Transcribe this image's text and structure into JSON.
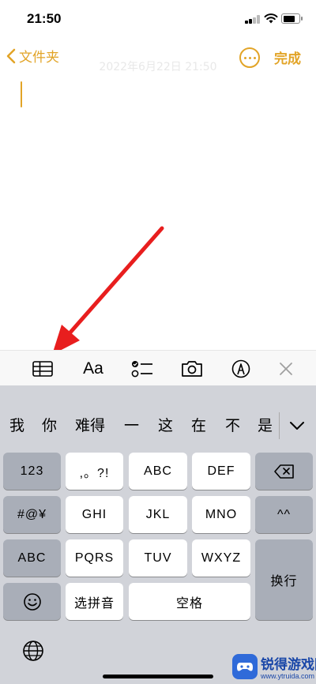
{
  "status_bar": {
    "time": "21:50"
  },
  "nav": {
    "back_label": "文件夹",
    "title": "2022年6月22日 21:50",
    "done_label": "完成"
  },
  "toolbar": {
    "items": [
      "table-icon",
      "Aa",
      "checklist-icon",
      "camera-icon",
      "markup-icon",
      "close-icon"
    ],
    "format_label": "Aa"
  },
  "candidates": [
    "我",
    "你",
    "难得",
    "一",
    "这",
    "在",
    "不",
    "是"
  ],
  "keys": {
    "num": "123",
    "punct": ",。?!",
    "abc_key": "ABC",
    "def_key": "DEF",
    "symbols": "#@¥",
    "ghi": "GHI",
    "jkl": "JKL",
    "mno": "MNO",
    "caret": "^^",
    "abc_mode": "ABC",
    "pqrs": "PQRS",
    "tuv": "TUV",
    "wxyz": "WXYZ",
    "return_label": "换行",
    "pinyin": "选拼音",
    "space": "空格"
  },
  "watermark": {
    "name": "锐得游戏网",
    "url": "www.ytruida.com"
  },
  "colors": {
    "accent": "#e2a427",
    "annotation_arrow": "#e81e1e",
    "keyboard_bg": "#d1d3d9"
  }
}
